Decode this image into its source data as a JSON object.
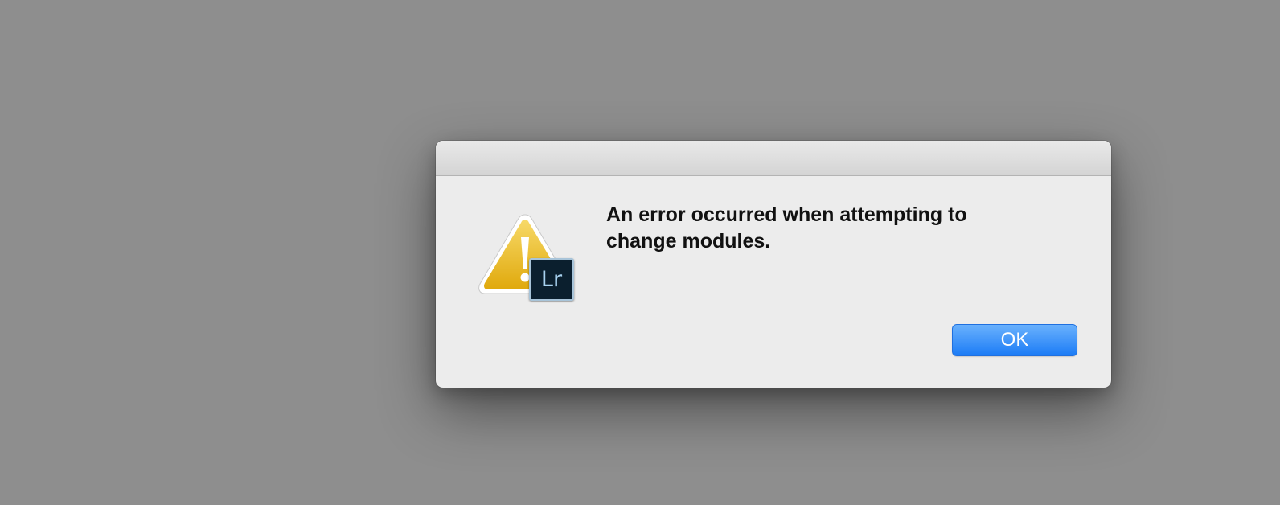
{
  "dialog": {
    "message": "An error occurred when attempting to change modules.",
    "icon": "warning-icon",
    "app_badge_label": "Lr",
    "ok_label": "OK"
  },
  "colors": {
    "desktop_background": "#8e8e8e",
    "dialog_background": "#ececec",
    "button_accent": "#1c7cf6",
    "warning_yellow": "#f2c12e",
    "app_badge_background": "#0b1f2e"
  }
}
